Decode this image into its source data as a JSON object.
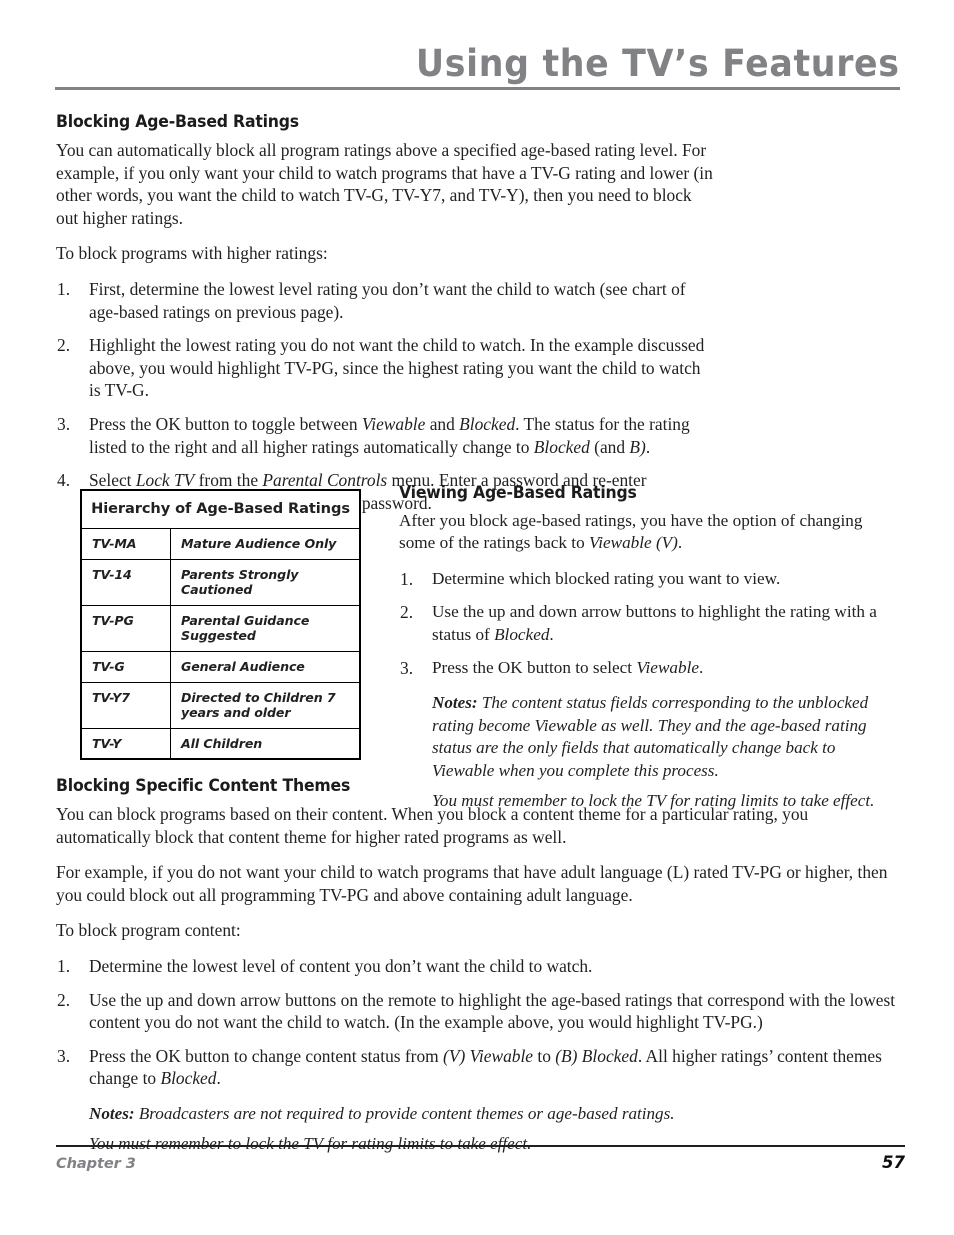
{
  "header": {
    "title": "Using the TV’s Features"
  },
  "section_blocking_age": {
    "heading": "Blocking Age-Based Ratings",
    "intro": "You can automatically block all program ratings above a specified age-based rating level. For example, if you only want your child to watch programs that have a TV-G rating and lower (in other words, you want the child to watch TV-G, TV-Y7, and TV-Y), then you need to block out higher ratings.",
    "lead_in": "To block programs with higher ratings:",
    "steps": [
      {
        "num": "1.",
        "parts": [
          {
            "text": "First, determine the lowest level rating you don’t want the child to watch (see chart of age-based ratings on previous page).",
            "style": "normal"
          }
        ]
      },
      {
        "num": "2.",
        "parts": [
          {
            "text": "Highlight the lowest rating you do not want the child to watch. In the example discussed above, you would highlight TV-PG, since the highest rating you want the child to watch is TV-G.",
            "style": "normal"
          }
        ]
      },
      {
        "num": "3.",
        "parts": [
          {
            "text": "Press the OK button to toggle between ",
            "style": "normal"
          },
          {
            "text": "Viewable",
            "style": "italic"
          },
          {
            "text": " and ",
            "style": "normal"
          },
          {
            "text": "Blocked",
            "style": "italic"
          },
          {
            "text": ". The status for the rating listed to the right and all higher ratings automatically change to ",
            "style": "normal"
          },
          {
            "text": "Blocked",
            "style": "italic"
          },
          {
            "text": " (and ",
            "style": "normal"
          },
          {
            "text": "B)",
            "style": "italic"
          },
          {
            "text": ".",
            "style": "normal"
          }
        ]
      },
      {
        "num": "4.",
        "parts": [
          {
            "text": "Select ",
            "style": "normal"
          },
          {
            "text": "Lock TV",
            "style": "italic"
          },
          {
            "text": " from the ",
            "style": "normal"
          },
          {
            "text": "Parental Controls",
            "style": "italic"
          },
          {
            "text": " menu. Enter a password and re-enter password a second time to confirm the password.",
            "style": "normal"
          }
        ]
      }
    ]
  },
  "ratings_table": {
    "title": "Hierarchy of Age-Based Ratings",
    "rows": [
      {
        "code": "TV-MA",
        "description": "Mature Audience Only"
      },
      {
        "code": "TV-14",
        "description": "Parents Strongly Cautioned"
      },
      {
        "code": "TV-PG",
        "description": "Parental Guidance Suggested"
      },
      {
        "code": "TV-G",
        "description": "General Audience"
      },
      {
        "code": "TV-Y7",
        "description": "Directed to Children 7 years and older"
      },
      {
        "code": "TV-Y",
        "description": "All Children"
      }
    ]
  },
  "section_viewing_age": {
    "heading": "Viewing Age-Based Ratings",
    "intro_parts": [
      {
        "text": "After you block age-based ratings, you have the option of changing some of the ratings back to ",
        "style": "normal"
      },
      {
        "text": "Viewable (V)",
        "style": "italic"
      },
      {
        "text": ".",
        "style": "normal"
      }
    ],
    "steps": [
      {
        "num": "1.",
        "parts": [
          {
            "text": "Determine which blocked rating you want to view.",
            "style": "normal"
          }
        ]
      },
      {
        "num": "2.",
        "parts": [
          {
            "text": "Use the up and down arrow buttons to highlight the rating with a status of ",
            "style": "normal"
          },
          {
            "text": "Blocked",
            "style": "italic"
          },
          {
            "text": ".",
            "style": "normal"
          }
        ]
      },
      {
        "num": "3.",
        "parts": [
          {
            "text": "Press the OK button to select ",
            "style": "normal"
          },
          {
            "text": "Viewable",
            "style": "italic"
          },
          {
            "text": ".",
            "style": "normal"
          }
        ]
      }
    ],
    "notes_label": "Notes:",
    "note_1": " The content status fields corresponding to the unblocked rating become Viewable as well. They and the age-based rating status are the only fields that automatically change back to Viewable when you complete this process.",
    "note_2": "You must remember to lock the TV for rating limits to take effect."
  },
  "section_content_themes": {
    "heading": "Blocking Specific Content Themes",
    "para_1": "You can block programs based on their content. When you block a content theme for a particular rating, you automatically block that content theme for higher rated programs as well.",
    "para_2": "For example, if you do not want your child to watch programs that have adult language (L) rated TV-PG or higher, then you could block out all programming TV-PG and above containing adult language.",
    "lead_in": "To block program content:",
    "steps": [
      {
        "num": "1.",
        "parts": [
          {
            "text": "Determine the lowest level of content you don’t want the child to watch.",
            "style": "normal"
          }
        ]
      },
      {
        "num": "2.",
        "parts": [
          {
            "text": "Use the up and down arrow buttons on the remote to highlight the age-based ratings that correspond with the lowest content you do not want the child to watch. (In the example above, you would highlight TV-PG.)",
            "style": "normal"
          }
        ]
      },
      {
        "num": "3.",
        "parts": [
          {
            "text": "Press the OK button to change content status from ",
            "style": "normal"
          },
          {
            "text": "(V) Viewable",
            "style": "italic"
          },
          {
            "text": " to ",
            "style": "normal"
          },
          {
            "text": "(B) Blocked",
            "style": "italic"
          },
          {
            "text": ". All higher ratings’ content themes change to ",
            "style": "normal"
          },
          {
            "text": "Blocked",
            "style": "italic"
          },
          {
            "text": ".",
            "style": "normal"
          }
        ]
      }
    ],
    "notes_label": "Notes:",
    "note_1": "  Broadcasters are not required to provide content themes or age-based ratings.",
    "note_2": "You must remember to lock the TV for rating limits to take effect."
  },
  "footer": {
    "chapter": "Chapter 3",
    "page_number": "57"
  }
}
